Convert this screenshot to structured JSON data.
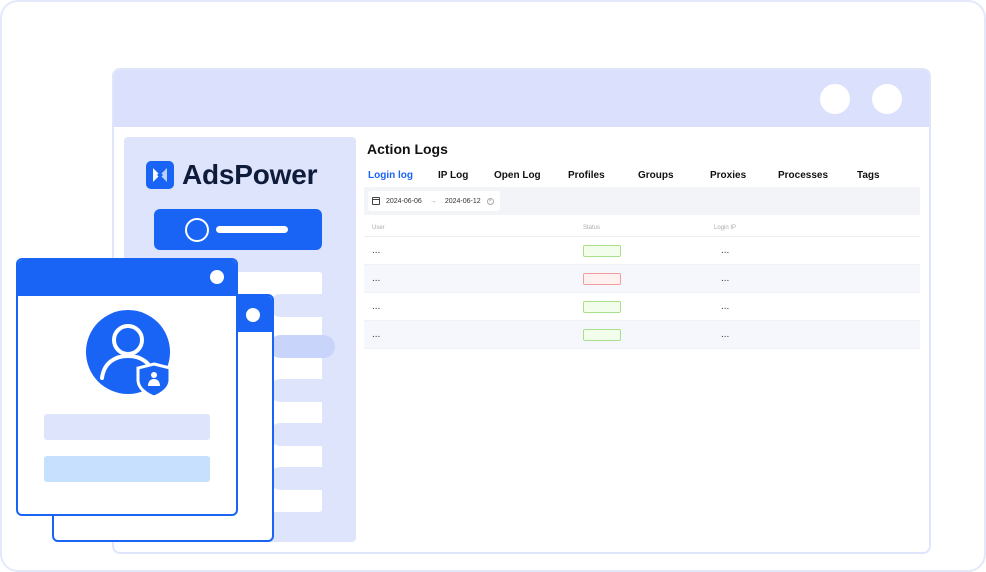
{
  "app": {
    "name": "AdsPower"
  },
  "page": {
    "title": "Action Logs"
  },
  "tabs": [
    {
      "label": "Login log",
      "active": true
    },
    {
      "label": "IP Log",
      "active": false
    },
    {
      "label": "Open Log",
      "active": false
    },
    {
      "label": "Profiles",
      "active": false
    },
    {
      "label": "Groups",
      "active": false
    },
    {
      "label": "Proxies",
      "active": false
    },
    {
      "label": "Processes",
      "active": false
    },
    {
      "label": "Tags",
      "active": false
    }
  ],
  "filter": {
    "date_start": "2024-06-06",
    "arrow": "→",
    "date_end": "2024-06-12"
  },
  "table": {
    "columns": [
      "User",
      "Status",
      "Login IP"
    ],
    "rows": [
      {
        "user": "...",
        "status": "success",
        "ip": "..."
      },
      {
        "user": "...",
        "status": "failed",
        "ip": "..."
      },
      {
        "user": "...",
        "status": "success",
        "ip": "..."
      },
      {
        "user": "...",
        "status": "success",
        "ip": "..."
      }
    ]
  },
  "colors": {
    "brand": "#1a64f5",
    "titlebar": "#dbe1fc",
    "status_success": "#a6e08a",
    "status_failed": "#f29c9c"
  },
  "icons": [
    "adspower-logo-icon",
    "calendar-icon",
    "clear-icon",
    "user-avatar-icon",
    "shield-icon"
  ]
}
